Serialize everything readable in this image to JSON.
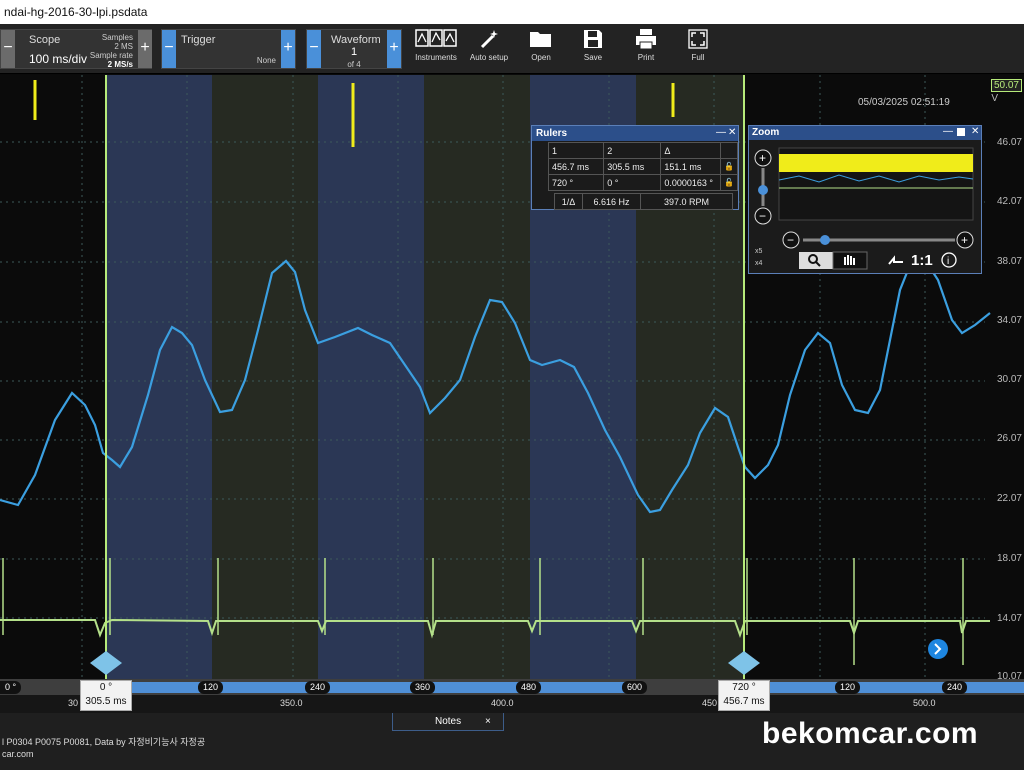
{
  "window": {
    "title": "ndai-hg-2016-30-lpi.psdata"
  },
  "toolbar": {
    "scope": {
      "label": "Scope",
      "timebase": "100 ms/div",
      "samples_label": "Samples",
      "samples_value": "2 MS",
      "rate_label": "Sample rate",
      "rate_value": "2 MS/s"
    },
    "trigger": {
      "label": "Trigger",
      "mode": "None"
    },
    "waveform": {
      "label": "Waveform",
      "current": "1",
      "of": "of 4"
    },
    "buttons": [
      {
        "name": "instruments",
        "label": "Instruments",
        "icon": "instruments-icon"
      },
      {
        "name": "auto-setup",
        "label": "Auto setup",
        "icon": "wand-icon"
      },
      {
        "name": "open",
        "label": "Open",
        "icon": "folder-icon"
      },
      {
        "name": "save",
        "label": "Save",
        "icon": "floppy-icon"
      },
      {
        "name": "print",
        "label": "Print",
        "icon": "printer-icon"
      },
      {
        "name": "full",
        "label": "Full",
        "icon": "fullscreen-icon"
      }
    ],
    "plus": "+",
    "minus": "−"
  },
  "plot": {
    "timestamp": "05/03/2025 02:51:19",
    "y_axis": {
      "unit": "V",
      "top_value": "50.07",
      "ticks": [
        "46.07",
        "42.07",
        "38.07",
        "34.07",
        "30.07",
        "26.07",
        "22.07",
        "18.07",
        "14.07",
        "10.07"
      ]
    },
    "colors": {
      "blue_trace": "#3b9fe0",
      "green_trace": "#b4e08a",
      "yellow_trace": "#f0ec1a",
      "band_blue": "#2b3755",
      "band_olive": "#262a22",
      "ruler": "#b6ea7a"
    }
  },
  "rulers": {
    "title": "Rulers",
    "header": [
      "1",
      "2",
      "Δ"
    ],
    "time_row": [
      "456.7 ms",
      "305.5 ms",
      "151.1 ms"
    ],
    "angle_row": [
      "720 °",
      "0 °",
      "0.0000163 °"
    ],
    "freq_row": {
      "label": "1/Δ",
      "freq": "6.616 Hz",
      "rpm": "397.0 RPM"
    }
  },
  "zoom": {
    "title": "Zoom",
    "x_zoom": "x5",
    "y_zoom": "x4",
    "reset_label": "1:1"
  },
  "scale": {
    "degrees": [
      "0 °",
      "0 °",
      "120",
      "240",
      "360",
      "480",
      "600",
      "720 °",
      "120",
      "240"
    ],
    "times": [
      "30",
      "350.0",
      "400.0",
      "450",
      "500.0"
    ],
    "marker_left": {
      "deg": "0 °",
      "time": "305.5 ms"
    },
    "marker_right": {
      "deg": "720 °",
      "time": "456.7 ms"
    }
  },
  "footer": {
    "notes_label": "Notes",
    "notes_close": "×",
    "info_line1": "l P0304 P0075 P0081, Data by 자정비기능사 자정공",
    "info_line2": "car.com",
    "brand": "bekomcar.com"
  }
}
